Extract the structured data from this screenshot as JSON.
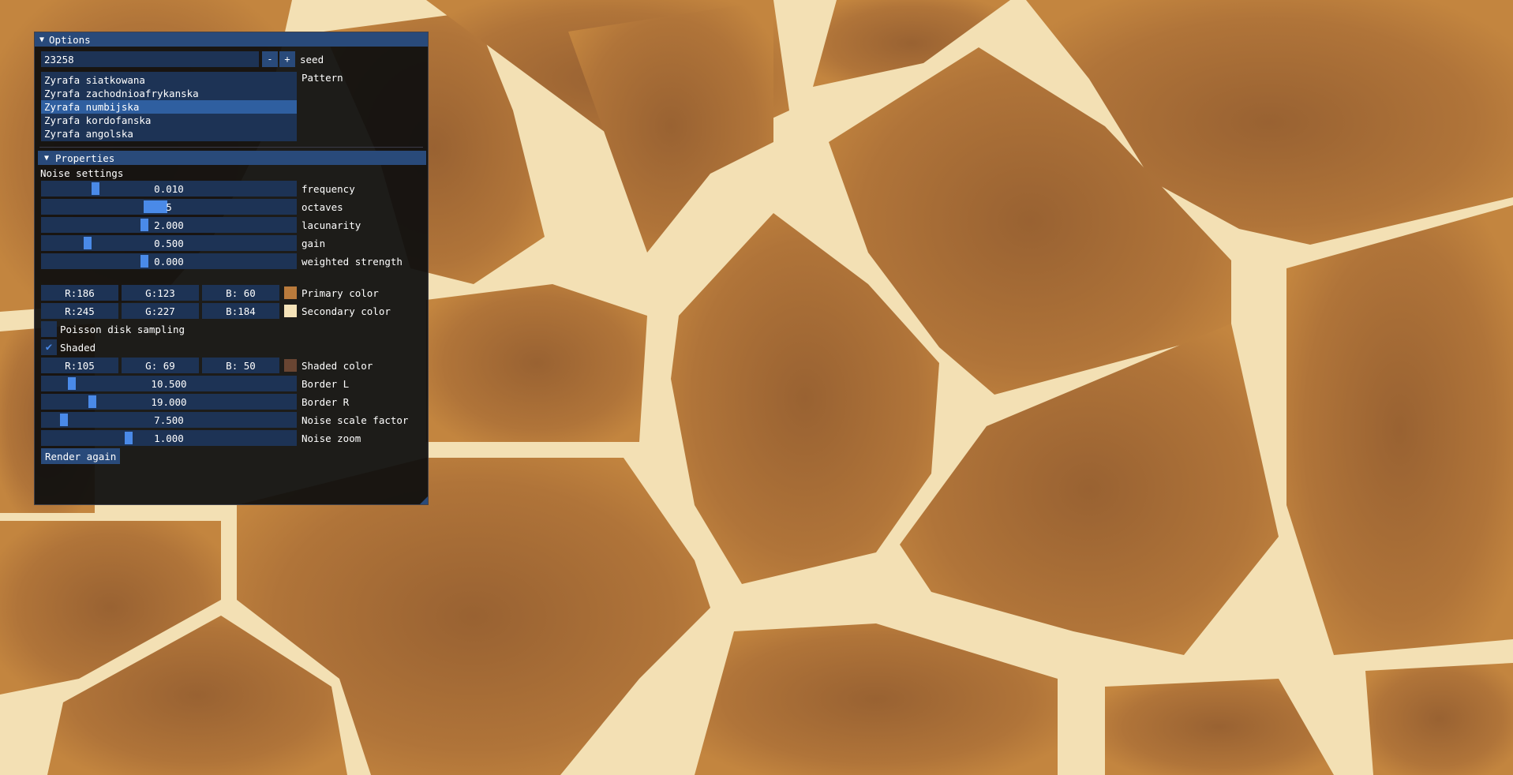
{
  "window": {
    "title": "Options"
  },
  "seed": {
    "value": "23258",
    "minus": "-",
    "plus": "+",
    "label": "seed"
  },
  "pattern": {
    "label": "Pattern",
    "items": [
      "Zyrafa siatkowana",
      "Zyrafa zachodnioafrykanska",
      "Zyrafa numbijska",
      "Zyrafa kordofanska",
      "Zyrafa angolska"
    ],
    "selected_index": 2
  },
  "properties": {
    "header": "Properties",
    "noise_title": "Noise settings",
    "sliders": [
      {
        "label": "frequency",
        "value": "0.010",
        "level": 0.2
      },
      {
        "label": "octaves",
        "value": "5",
        "level": 0.4
      },
      {
        "label": "lacunarity",
        "value": "2.000",
        "level": 0.4
      },
      {
        "label": "gain",
        "value": "0.500",
        "level": 0.17
      },
      {
        "label": "weighted strength",
        "value": "0.000",
        "level": 0.4
      }
    ]
  },
  "colors": {
    "primary": {
      "label": "Primary color",
      "r": "R:186",
      "g": "G:123",
      "b": "B: 60",
      "hex": "#ba7b3c"
    },
    "secondary": {
      "label": "Secondary color",
      "r": "R:245",
      "g": "G:227",
      "b": "B:184",
      "hex": "#f5e3b8"
    },
    "shaded": {
      "label": "Shaded color",
      "r": "R:105",
      "g": "G: 69",
      "b": "B: 50",
      "hex": "#694532"
    }
  },
  "poisson": {
    "label": "Poisson disk sampling",
    "checked": false
  },
  "shaded": {
    "label": "Shaded",
    "checked": true
  },
  "border_sliders": [
    {
      "label": "Border L",
      "value": "10.500",
      "level": 0.1
    },
    {
      "label": "Border R",
      "value": "19.000",
      "level": 0.19
    },
    {
      "label": "Noise scale factor",
      "value": "7.500",
      "level": 0.07
    },
    {
      "label": "Noise zoom",
      "value": "1.000",
      "level": 0.34
    }
  ],
  "render_button": "Render again",
  "accent": "#4a8ae8"
}
